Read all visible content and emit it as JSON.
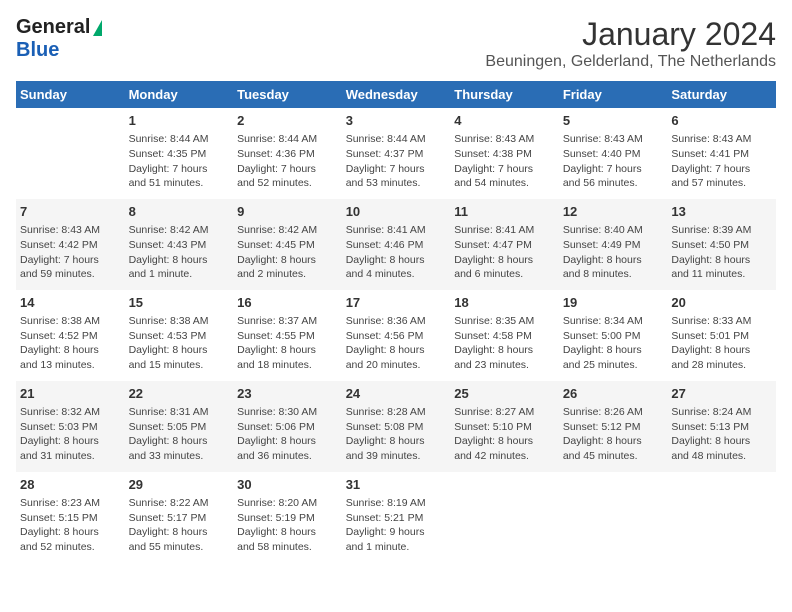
{
  "logo": {
    "general": "General",
    "blue": "Blue"
  },
  "title": "January 2024",
  "subtitle": "Beuningen, Gelderland, The Netherlands",
  "columns": [
    "Sunday",
    "Monday",
    "Tuesday",
    "Wednesday",
    "Thursday",
    "Friday",
    "Saturday"
  ],
  "weeks": [
    [
      {
        "day": "",
        "lines": []
      },
      {
        "day": "1",
        "lines": [
          "Sunrise: 8:44 AM",
          "Sunset: 4:35 PM",
          "Daylight: 7 hours",
          "and 51 minutes."
        ]
      },
      {
        "day": "2",
        "lines": [
          "Sunrise: 8:44 AM",
          "Sunset: 4:36 PM",
          "Daylight: 7 hours",
          "and 52 minutes."
        ]
      },
      {
        "day": "3",
        "lines": [
          "Sunrise: 8:44 AM",
          "Sunset: 4:37 PM",
          "Daylight: 7 hours",
          "and 53 minutes."
        ]
      },
      {
        "day": "4",
        "lines": [
          "Sunrise: 8:43 AM",
          "Sunset: 4:38 PM",
          "Daylight: 7 hours",
          "and 54 minutes."
        ]
      },
      {
        "day": "5",
        "lines": [
          "Sunrise: 8:43 AM",
          "Sunset: 4:40 PM",
          "Daylight: 7 hours",
          "and 56 minutes."
        ]
      },
      {
        "day": "6",
        "lines": [
          "Sunrise: 8:43 AM",
          "Sunset: 4:41 PM",
          "Daylight: 7 hours",
          "and 57 minutes."
        ]
      }
    ],
    [
      {
        "day": "7",
        "lines": [
          "Sunrise: 8:43 AM",
          "Sunset: 4:42 PM",
          "Daylight: 7 hours",
          "and 59 minutes."
        ]
      },
      {
        "day": "8",
        "lines": [
          "Sunrise: 8:42 AM",
          "Sunset: 4:43 PM",
          "Daylight: 8 hours",
          "and 1 minute."
        ]
      },
      {
        "day": "9",
        "lines": [
          "Sunrise: 8:42 AM",
          "Sunset: 4:45 PM",
          "Daylight: 8 hours",
          "and 2 minutes."
        ]
      },
      {
        "day": "10",
        "lines": [
          "Sunrise: 8:41 AM",
          "Sunset: 4:46 PM",
          "Daylight: 8 hours",
          "and 4 minutes."
        ]
      },
      {
        "day": "11",
        "lines": [
          "Sunrise: 8:41 AM",
          "Sunset: 4:47 PM",
          "Daylight: 8 hours",
          "and 6 minutes."
        ]
      },
      {
        "day": "12",
        "lines": [
          "Sunrise: 8:40 AM",
          "Sunset: 4:49 PM",
          "Daylight: 8 hours",
          "and 8 minutes."
        ]
      },
      {
        "day": "13",
        "lines": [
          "Sunrise: 8:39 AM",
          "Sunset: 4:50 PM",
          "Daylight: 8 hours",
          "and 11 minutes."
        ]
      }
    ],
    [
      {
        "day": "14",
        "lines": [
          "Sunrise: 8:38 AM",
          "Sunset: 4:52 PM",
          "Daylight: 8 hours",
          "and 13 minutes."
        ]
      },
      {
        "day": "15",
        "lines": [
          "Sunrise: 8:38 AM",
          "Sunset: 4:53 PM",
          "Daylight: 8 hours",
          "and 15 minutes."
        ]
      },
      {
        "day": "16",
        "lines": [
          "Sunrise: 8:37 AM",
          "Sunset: 4:55 PM",
          "Daylight: 8 hours",
          "and 18 minutes."
        ]
      },
      {
        "day": "17",
        "lines": [
          "Sunrise: 8:36 AM",
          "Sunset: 4:56 PM",
          "Daylight: 8 hours",
          "and 20 minutes."
        ]
      },
      {
        "day": "18",
        "lines": [
          "Sunrise: 8:35 AM",
          "Sunset: 4:58 PM",
          "Daylight: 8 hours",
          "and 23 minutes."
        ]
      },
      {
        "day": "19",
        "lines": [
          "Sunrise: 8:34 AM",
          "Sunset: 5:00 PM",
          "Daylight: 8 hours",
          "and 25 minutes."
        ]
      },
      {
        "day": "20",
        "lines": [
          "Sunrise: 8:33 AM",
          "Sunset: 5:01 PM",
          "Daylight: 8 hours",
          "and 28 minutes."
        ]
      }
    ],
    [
      {
        "day": "21",
        "lines": [
          "Sunrise: 8:32 AM",
          "Sunset: 5:03 PM",
          "Daylight: 8 hours",
          "and 31 minutes."
        ]
      },
      {
        "day": "22",
        "lines": [
          "Sunrise: 8:31 AM",
          "Sunset: 5:05 PM",
          "Daylight: 8 hours",
          "and 33 minutes."
        ]
      },
      {
        "day": "23",
        "lines": [
          "Sunrise: 8:30 AM",
          "Sunset: 5:06 PM",
          "Daylight: 8 hours",
          "and 36 minutes."
        ]
      },
      {
        "day": "24",
        "lines": [
          "Sunrise: 8:28 AM",
          "Sunset: 5:08 PM",
          "Daylight: 8 hours",
          "and 39 minutes."
        ]
      },
      {
        "day": "25",
        "lines": [
          "Sunrise: 8:27 AM",
          "Sunset: 5:10 PM",
          "Daylight: 8 hours",
          "and 42 minutes."
        ]
      },
      {
        "day": "26",
        "lines": [
          "Sunrise: 8:26 AM",
          "Sunset: 5:12 PM",
          "Daylight: 8 hours",
          "and 45 minutes."
        ]
      },
      {
        "day": "27",
        "lines": [
          "Sunrise: 8:24 AM",
          "Sunset: 5:13 PM",
          "Daylight: 8 hours",
          "and 48 minutes."
        ]
      }
    ],
    [
      {
        "day": "28",
        "lines": [
          "Sunrise: 8:23 AM",
          "Sunset: 5:15 PM",
          "Daylight: 8 hours",
          "and 52 minutes."
        ]
      },
      {
        "day": "29",
        "lines": [
          "Sunrise: 8:22 AM",
          "Sunset: 5:17 PM",
          "Daylight: 8 hours",
          "and 55 minutes."
        ]
      },
      {
        "day": "30",
        "lines": [
          "Sunrise: 8:20 AM",
          "Sunset: 5:19 PM",
          "Daylight: 8 hours",
          "and 58 minutes."
        ]
      },
      {
        "day": "31",
        "lines": [
          "Sunrise: 8:19 AM",
          "Sunset: 5:21 PM",
          "Daylight: 9 hours",
          "and 1 minute."
        ]
      },
      {
        "day": "",
        "lines": []
      },
      {
        "day": "",
        "lines": []
      },
      {
        "day": "",
        "lines": []
      }
    ]
  ]
}
